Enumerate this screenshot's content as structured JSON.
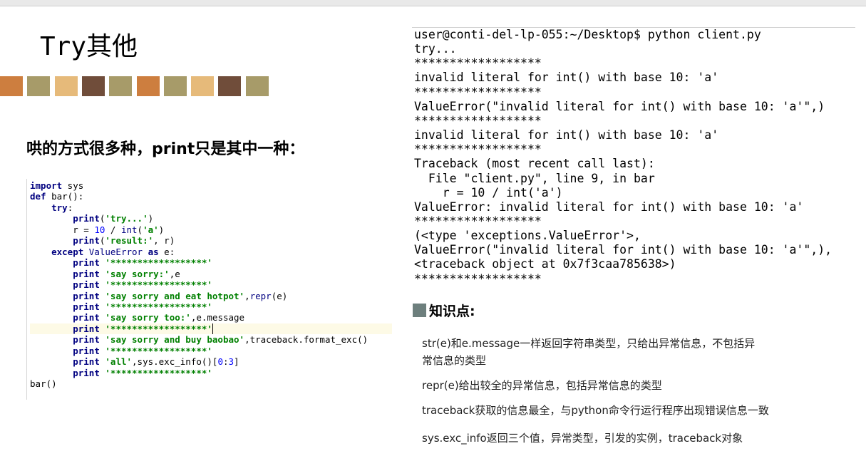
{
  "slide": {
    "title": "Try其他",
    "subtitle": "哄的方式很多种，print只是其中一种："
  },
  "swatch_colors": [
    "#cd7e3f",
    "#a79b69",
    "#e6ba7a",
    "#704d3a",
    "#a79b69",
    "#cd7e3f",
    "#a79b69",
    "#e6ba7a",
    "#704d3a",
    "#a79b69"
  ],
  "code": {
    "current_line_index": 13,
    "lines": [
      [
        [
          "kw",
          "import"
        ],
        [
          "t",
          " sys"
        ]
      ],
      [
        [
          "kw",
          "def"
        ],
        [
          "t",
          " bar():"
        ]
      ],
      [
        [
          "t",
          "    "
        ],
        [
          "kw",
          "try"
        ],
        [
          "t",
          ":"
        ]
      ],
      [
        [
          "t",
          "        "
        ],
        [
          "kw",
          "print"
        ],
        [
          "t",
          "("
        ],
        [
          "str",
          "'try...'"
        ],
        [
          "t",
          ")"
        ]
      ],
      [
        [
          "t",
          "        r = "
        ],
        [
          "num",
          "10"
        ],
        [
          "t",
          " / "
        ],
        [
          "bi",
          "int"
        ],
        [
          "t",
          "("
        ],
        [
          "str",
          "'a'"
        ],
        [
          "t",
          ")"
        ]
      ],
      [
        [
          "t",
          "        "
        ],
        [
          "kw",
          "print"
        ],
        [
          "t",
          "("
        ],
        [
          "str",
          "'result:'"
        ],
        [
          "t",
          ", r)"
        ]
      ],
      [
        [
          "t",
          "    "
        ],
        [
          "kw",
          "except"
        ],
        [
          "t",
          " "
        ],
        [
          "bi",
          "ValueError"
        ],
        [
          "t",
          " "
        ],
        [
          "kw",
          "as"
        ],
        [
          "t",
          " e:"
        ]
      ],
      [
        [
          "t",
          "        "
        ],
        [
          "kw",
          "print"
        ],
        [
          "t",
          " "
        ],
        [
          "str",
          "'******************'"
        ]
      ],
      [
        [
          "t",
          "        "
        ],
        [
          "kw",
          "print"
        ],
        [
          "t",
          " "
        ],
        [
          "str",
          "'say sorry:'"
        ],
        [
          "t",
          ",e"
        ]
      ],
      [
        [
          "t",
          "        "
        ],
        [
          "kw",
          "print"
        ],
        [
          "t",
          " "
        ],
        [
          "str",
          "'******************'"
        ]
      ],
      [
        [
          "t",
          "        "
        ],
        [
          "kw",
          "print"
        ],
        [
          "t",
          " "
        ],
        [
          "str",
          "'say sorry and eat hotpot'"
        ],
        [
          "t",
          ","
        ],
        [
          "bi",
          "repr"
        ],
        [
          "t",
          "(e)"
        ]
      ],
      [
        [
          "t",
          "        "
        ],
        [
          "kw",
          "print"
        ],
        [
          "t",
          " "
        ],
        [
          "str",
          "'******************'"
        ]
      ],
      [
        [
          "t",
          "        "
        ],
        [
          "kw",
          "print"
        ],
        [
          "t",
          " "
        ],
        [
          "str",
          "'say sorry too:'"
        ],
        [
          "t",
          ",e.message"
        ]
      ],
      [
        [
          "t",
          "        "
        ],
        [
          "kw",
          "print"
        ],
        [
          "t",
          " "
        ],
        [
          "str",
          "'******************'"
        ],
        [
          "cur",
          ""
        ]
      ],
      [
        [
          "t",
          "        "
        ],
        [
          "kw",
          "print"
        ],
        [
          "t",
          " "
        ],
        [
          "str",
          "'say sorry and buy baobao'"
        ],
        [
          "t",
          ",traceback.format_exc()"
        ]
      ],
      [
        [
          "t",
          "        "
        ],
        [
          "kw",
          "print"
        ],
        [
          "t",
          " "
        ],
        [
          "str",
          "'******************'"
        ]
      ],
      [
        [
          "t",
          "        "
        ],
        [
          "kw",
          "print"
        ],
        [
          "t",
          " "
        ],
        [
          "str",
          "'all'"
        ],
        [
          "t",
          ",sys.exc_info()["
        ],
        [
          "num",
          "0"
        ],
        [
          "t",
          ":"
        ],
        [
          "num",
          "3"
        ],
        [
          "t",
          "]"
        ]
      ],
      [
        [
          "t",
          "        "
        ],
        [
          "kw",
          "print"
        ],
        [
          "t",
          " "
        ],
        [
          "str",
          "'******************'"
        ]
      ],
      [
        [
          "t",
          "bar()"
        ]
      ]
    ]
  },
  "terminal": {
    "lines": [
      "user@conti-del-lp-055:~/Desktop$ python client.py",
      "try...",
      "******************",
      "invalid literal for int() with base 10: 'a'",
      "******************",
      "ValueError(\"invalid literal for int() with base 10: 'a'\",)",
      "******************",
      "invalid literal for int() with base 10: 'a'",
      "******************",
      "Traceback (most recent call last):",
      "  File \"client.py\", line 9, in bar",
      "    r = 10 / int('a')",
      "ValueError: invalid literal for int() with base 10: 'a'",
      "******************",
      "(<type 'exceptions.ValueError'>,",
      "ValueError(\"invalid literal for int() with base 10: 'a'\",),",
      "<traceback object at 0x7f3caa785638>)",
      "******************"
    ]
  },
  "knowledge": {
    "title": "知识点:",
    "items": [
      "str(e)和e.message一样返回字符串类型，只给出异常信息，不包括异常信息的类型",
      "repr(e)给出较全的异常信息，包括异常信息的类型",
      "traceback获取的信息最全，与python命令行运行程序出现错误信息一致",
      "sys.exc_info返回三个值，异常类型，引发的实例，traceback对象"
    ]
  }
}
